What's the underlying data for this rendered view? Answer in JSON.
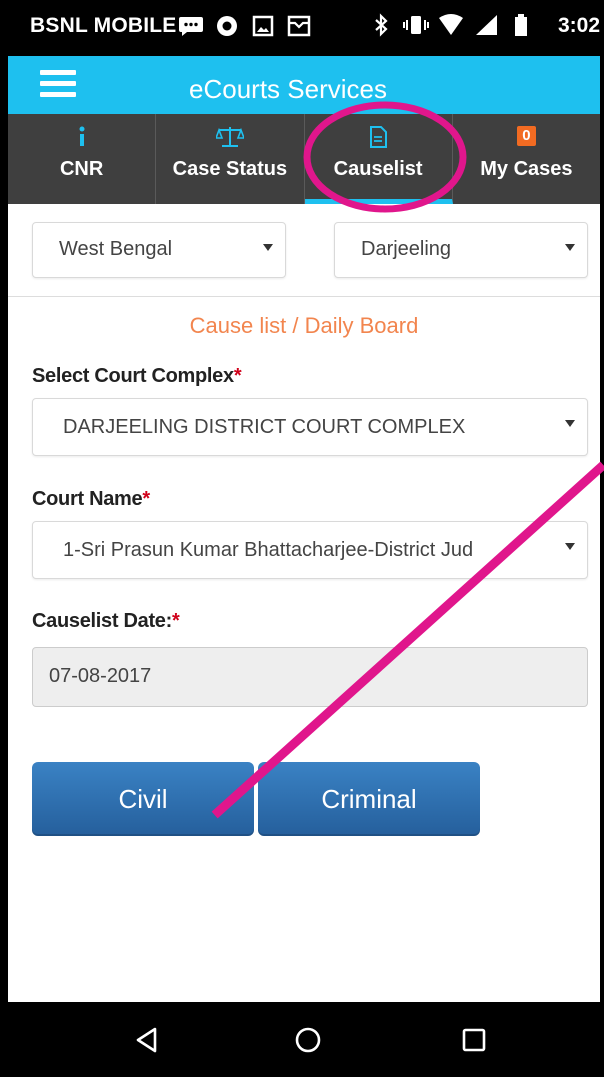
{
  "status_bar": {
    "carrier": "BSNL MOBILE",
    "time": "3:02",
    "icons_left": [
      "message-icon",
      "circle-icon",
      "image-icon",
      "mail-icon"
    ],
    "icons_right": [
      "bluetooth-icon",
      "vibrate-icon",
      "wifi-icon",
      "signal-icon",
      "battery-icon"
    ]
  },
  "app_bar": {
    "title": "eCourts Services",
    "menu_icon": "hamburger-icon",
    "color": "#1ec0ef"
  },
  "tabs": [
    {
      "label": "CNR",
      "icon": "info-icon",
      "active": false
    },
    {
      "label": "Case Status",
      "icon": "scales-icon",
      "active": false
    },
    {
      "label": "Causelist",
      "icon": "document-icon",
      "active": true
    },
    {
      "label": "My Cases",
      "icon": "badge",
      "badge": "0",
      "active": false
    }
  ],
  "location": {
    "state": "West Bengal",
    "district": "Darjeeling"
  },
  "form": {
    "title": "Cause list / Daily Board",
    "court_complex_label": "Select Court Complex",
    "court_complex_value": "DARJEELING DISTRICT COURT COMPLEX",
    "court_name_label": "Court Name",
    "court_name_value": "1-Sri Prasun Kumar Bhattacharjee-District Jud",
    "date_label": "Causelist Date:",
    "date_value": "07-08-2017",
    "required_mark": "*"
  },
  "buttons": {
    "civil": "Civil",
    "criminal": "Criminal"
  },
  "colors": {
    "accent": "#1ec0ef",
    "tab_bg": "#3f3f3f",
    "title_orange": "#f2854e",
    "button_blue": "#2d6fb0",
    "annotation_magenta": "#e0168c"
  }
}
